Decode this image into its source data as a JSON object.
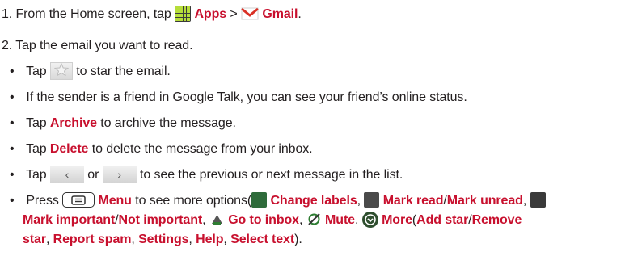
{
  "step1": {
    "prefix": "1. From the Home screen, tap",
    "apps": "Apps",
    "gt": ">",
    "gmail": "Gmail",
    "end": "."
  },
  "step2": {
    "text": "2. Tap the email you want to read."
  },
  "bullets": {
    "star": {
      "pre": "Tap",
      "post": "to star the email."
    },
    "friend": {
      "text": "If the sender is a friend in Google Talk, you can see your friend’s online status."
    },
    "archive": {
      "pre": "Tap",
      "term": "Archive",
      "post": "to archive the message."
    },
    "delete": {
      "pre": "Tap",
      "term": "Delete",
      "post": "to delete the message from your inbox."
    },
    "nav": {
      "pre": "Tap",
      "or": "or",
      "post": "to see the previous or next message in the list."
    },
    "menu": {
      "pre": "Press",
      "menu": "Menu",
      "mid": "to see more options(",
      "change_labels": "Change labels",
      "mark_read": "Mark read",
      "mark_unread": "Mark unread",
      "mark_important": "Mark important",
      "not_important": "Not important",
      "go_to_inbox": "Go to inbox",
      "mute": "Mute",
      "more": "More",
      "add_star": "Add star",
      "remove": "Remove",
      "star": "star",
      "report_spam": "Report spam",
      "settings": "Settings",
      "help": "Help",
      "select_text": "Select text",
      "slash": "/",
      "comma": ",",
      "open_paren": "(",
      "close": ")."
    }
  },
  "colors": {
    "accent": "#c8102e",
    "text": "#231f20"
  },
  "icons": [
    "apps-grid-icon",
    "gmail-icon",
    "star-icon",
    "prev-arrow-icon",
    "next-arrow-icon",
    "menu-key-icon",
    "change-labels-icon",
    "mark-read-icon",
    "mark-important-icon",
    "go-to-inbox-icon",
    "mute-icon",
    "more-icon"
  ]
}
